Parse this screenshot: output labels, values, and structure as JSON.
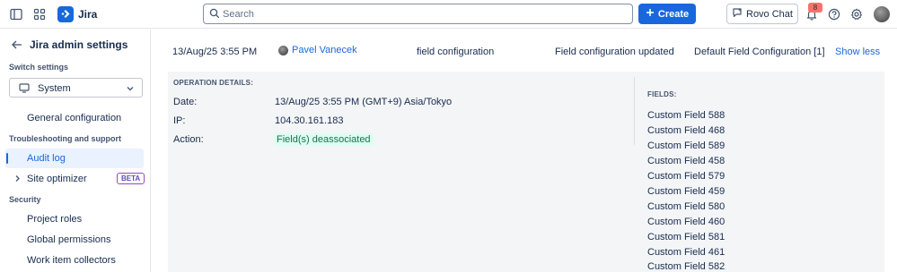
{
  "topnav": {
    "app_name": "Jira",
    "search_placeholder": "Search",
    "create_label": "Create",
    "rovo_label": "Rovo Chat",
    "notification_count": "8",
    "icons": [
      "sidebar-toggle-icon",
      "app-switcher-icon",
      "jira-logo-icon",
      "search-icon",
      "plus-icon",
      "rovo-chat-icon",
      "bell-icon",
      "help-icon",
      "gear-icon"
    ]
  },
  "sidebar": {
    "title": "Jira admin settings",
    "switch_heading": "Switch settings",
    "switch_value": "System",
    "items": [
      {
        "label": "General configuration"
      },
      {
        "label": "Audit log",
        "active": true
      },
      {
        "label": "Site optimizer",
        "badge": "BETA"
      },
      {
        "label": "Project roles"
      },
      {
        "label": "Global permissions"
      },
      {
        "label": "Work item collectors"
      }
    ],
    "sections": [
      "Troubleshooting and support",
      "Security"
    ]
  },
  "log_row": {
    "date": "13/Aug/25 3:55 PM",
    "author": "Pavel Vanecek",
    "category": "field configuration",
    "summary": "Field configuration updated",
    "object": "Default Field Configuration [1]",
    "toggle": "Show less"
  },
  "details": {
    "heading": "OPERATION DETAILS:",
    "date_label": "Date:",
    "date_value": "13/Aug/25 3:55 PM (GMT+9) Asia/Tokyo",
    "ip_label": "IP:",
    "ip_value": "104.30.161.183",
    "action_label": "Action:",
    "action_value": "Field(s) deassociated",
    "fields_heading": "FIELDS:",
    "fields": [
      "Custom Field 588",
      "Custom Field 468",
      "Custom Field 589",
      "Custom Field 458",
      "Custom Field 579",
      "Custom Field 459",
      "Custom Field 580",
      "Custom Field 460",
      "Custom Field 581",
      "Custom Field 461",
      "Custom Field 582"
    ]
  },
  "colors": {
    "brand": "#1868db",
    "action_bg": "#dcfff1",
    "action_text": "#216e4e",
    "badge_bg": "#f87168"
  }
}
